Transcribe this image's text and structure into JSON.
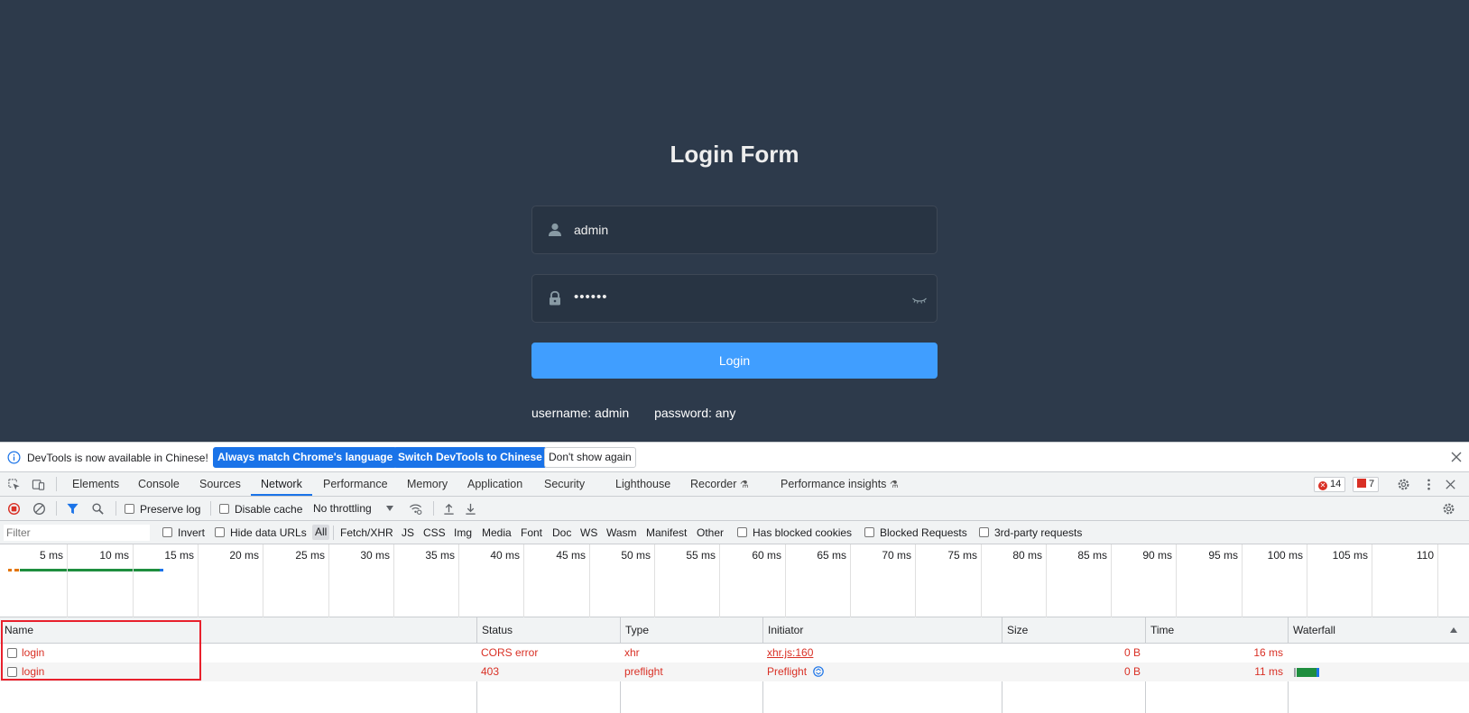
{
  "page": {
    "title": "Login Form",
    "username_value": "admin",
    "password_value": "••••••",
    "login_label": "Login",
    "tip_username": "username: admin",
    "tip_password": "password: any",
    "colors": {
      "background": "#2d3a4b",
      "button": "#409eff"
    },
    "icons": [
      "user-icon",
      "lock-icon",
      "eye-closed-icon"
    ]
  },
  "devtools": {
    "infobar": {
      "text": "DevTools is now available in Chinese!",
      "match_language": "Always match Chrome's language",
      "switch_chinese": "Switch DevTools to Chinese",
      "dont_show": "Don't show again"
    },
    "tabs": [
      "Elements",
      "Console",
      "Sources",
      "Network",
      "Performance",
      "Memory",
      "Application",
      "Security",
      "Lighthouse",
      "Recorder",
      "Performance insights"
    ],
    "active_tab": "Network",
    "error_count": "14",
    "warning_count": "7",
    "toolbar": {
      "preserve_log": "Preserve log",
      "disable_cache": "Disable cache",
      "throttling": "No throttling"
    },
    "filterbar": {
      "placeholder": "Filter",
      "invert": "Invert",
      "hide_data_urls": "Hide data URLs",
      "types": [
        "All",
        "Fetch/XHR",
        "JS",
        "CSS",
        "Img",
        "Media",
        "Font",
        "Doc",
        "WS",
        "Wasm",
        "Manifest",
        "Other"
      ],
      "has_blocked_cookies": "Has blocked cookies",
      "blocked_requests": "Blocked Requests",
      "third_party": "3rd-party requests"
    },
    "timeline_labels": [
      "5 ms",
      "10 ms",
      "15 ms",
      "20 ms",
      "25 ms",
      "30 ms",
      "35 ms",
      "40 ms",
      "45 ms",
      "50 ms",
      "55 ms",
      "60 ms",
      "65 ms",
      "70 ms",
      "75 ms",
      "80 ms",
      "85 ms",
      "90 ms",
      "95 ms",
      "100 ms",
      "105 ms",
      "110"
    ],
    "columns": {
      "name": "Name",
      "status": "Status",
      "type": "Type",
      "initiator": "Initiator",
      "size": "Size",
      "time": "Time",
      "waterfall": "Waterfall"
    },
    "requests": [
      {
        "name": "login",
        "status": "CORS error",
        "type": "xhr",
        "initiator": "xhr.js:160",
        "size": "0 B",
        "time": "16 ms"
      },
      {
        "name": "login",
        "status": "403",
        "type": "preflight",
        "initiator": "Preflight",
        "size": "0 B",
        "time": "11 ms"
      }
    ],
    "colors": {
      "error_red": "#d93025",
      "accent_blue": "#1a73e8",
      "highlight": "#e8202c"
    }
  }
}
